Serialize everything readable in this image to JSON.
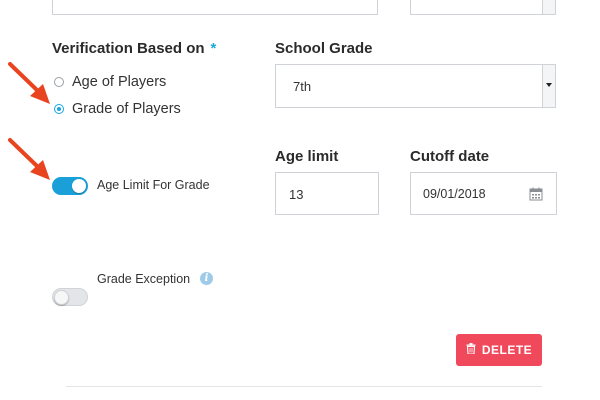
{
  "verification": {
    "label": "Verification Based on",
    "required_mark": "*",
    "options": [
      {
        "label": "Age of Players",
        "selected": false
      },
      {
        "label": "Grade of Players",
        "selected": true
      }
    ]
  },
  "school_grade": {
    "label": "School Grade",
    "value": "7th"
  },
  "age_limit_toggle": {
    "label": "Age Limit For Grade",
    "on": true
  },
  "age_limit": {
    "label": "Age limit",
    "value": "13"
  },
  "cutoff_date": {
    "label": "Cutoff date",
    "value": "09/01/2018",
    "icon": "calendar-icon"
  },
  "grade_exception": {
    "label": "Grade Exception",
    "on": false,
    "icon": "info-icon"
  },
  "delete_button": {
    "label": "DELETE",
    "icon": "trash-icon"
  },
  "colors": {
    "accent": "#1aa6e0",
    "danger": "#f0495c",
    "annotation_arrow": "#e8441f"
  }
}
